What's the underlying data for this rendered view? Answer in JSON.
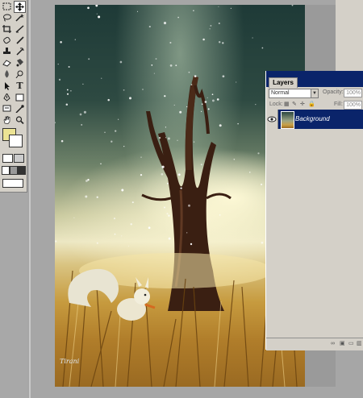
{
  "toolbox": {
    "tools": [
      "move-tool",
      "marquee-tool",
      "lasso-tool",
      "magic-wand-tool",
      "crop-tool",
      "slice-tool",
      "healing-brush-tool",
      "brush-tool",
      "clone-stamp-tool",
      "history-brush-tool",
      "eraser-tool",
      "gradient-tool",
      "blur-tool",
      "dodge-tool",
      "path-selection-tool",
      "type-tool",
      "pen-tool",
      "shape-tool",
      "notes-tool",
      "eyedropper-tool",
      "hand-tool",
      "zoom-tool"
    ],
    "type_glyph": "T",
    "foreground_color": "#ece394",
    "background_color": "#ffffff"
  },
  "layers_panel": {
    "tab_label": "Layers",
    "blend_mode": "Normal",
    "opacity_label": "Opacity:",
    "opacity_value": "100%",
    "lock_label": "Lock:",
    "fill_label": "Fill:",
    "fill_value": "100%",
    "layers": [
      {
        "name": "Background",
        "selected": true,
        "visible": true
      }
    ]
  },
  "canvas": {
    "signature": "Tirani"
  },
  "colors": {
    "selection_blue": "#0a246a",
    "panel_gray": "#d4d0c8",
    "workspace_gray": "#a6a6a6"
  }
}
